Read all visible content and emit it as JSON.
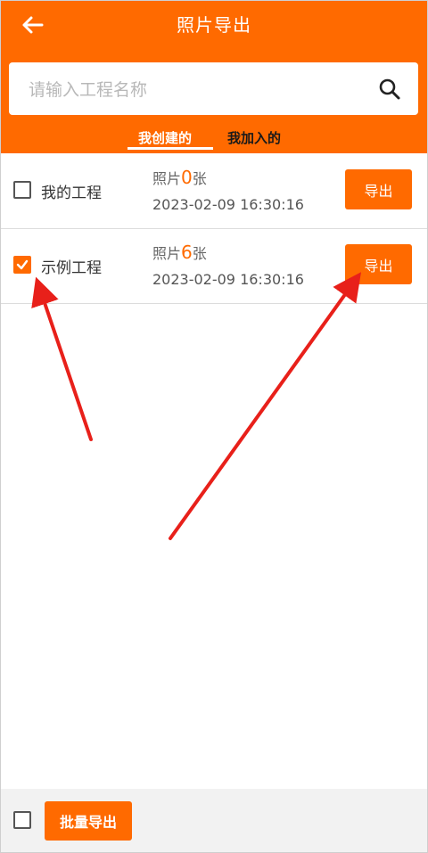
{
  "header": {
    "title": "照片导出",
    "back_icon": "arrow-left-icon",
    "background": "#ff6a00"
  },
  "search": {
    "placeholder": "请输入工程名称",
    "value": "",
    "icon": "search-icon"
  },
  "tabs": [
    {
      "label": "我创建的",
      "active": true
    },
    {
      "label": "我加入的",
      "active": false
    }
  ],
  "projects": [
    {
      "name": "我的工程",
      "photos_prefix": "照片",
      "photo_count": "0",
      "photos_suffix": "张",
      "date": "2023-02-09 16:30:16",
      "checked": false,
      "export_label": "导出"
    },
    {
      "name": "示例工程",
      "photos_prefix": "照片",
      "photo_count": "6",
      "photos_suffix": "张",
      "date": "2023-02-09 16:30:16",
      "checked": true,
      "export_label": "导出"
    }
  ],
  "bottom_bar": {
    "select_all_checked": false,
    "batch_export_label": "批量导出"
  },
  "colors": {
    "accent": "#ff6a00",
    "annotation_arrow": "#e8201a"
  }
}
